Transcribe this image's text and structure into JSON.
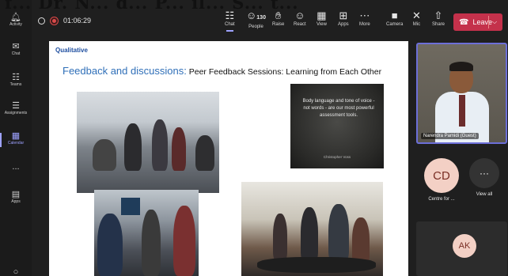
{
  "overlay_title": "f... Dr. N... d... P... il... S... t...",
  "rail": [
    {
      "label": "Activity",
      "icon": "bell-icon"
    },
    {
      "label": "Chat",
      "icon": "chat-icon"
    },
    {
      "label": "Teams",
      "icon": "teams-icon"
    },
    {
      "label": "Assignments",
      "icon": "assignments-icon"
    },
    {
      "label": "Calendar",
      "icon": "calendar-icon"
    },
    {
      "label": "...",
      "icon": "more-icon"
    },
    {
      "label": "Apps",
      "icon": "apps-icon"
    },
    {
      "label": "",
      "icon": "help-icon"
    }
  ],
  "meeting": {
    "timer": "01:06:29"
  },
  "toolbar": {
    "chat": "Chat",
    "people": "People",
    "people_count": "130",
    "raise": "Raise",
    "react": "React",
    "view": "View",
    "apps": "Apps",
    "more": "More",
    "camera": "Camera",
    "mic": "Mic",
    "share": "Share",
    "leave": "Leave"
  },
  "slide": {
    "tag": "Qualitative",
    "title_main": "Feedback and discussions:",
    "title_sub": " Peer Feedback Sessions: Learning from Each Other",
    "quote": "Body language and tone of voice - not words - are our most powerful assessment tools.",
    "quote_attr": "Christopher Voss"
  },
  "participants": {
    "presenter_name": "Narendra Pamidi (Guest)",
    "tiles": [
      {
        "initials": "CD",
        "label": "Centre for ..."
      },
      {
        "initials": "···",
        "label": "View all"
      }
    ],
    "bottom_initials": "AK"
  },
  "colors": {
    "accent": "#9ea2ff",
    "leave": "#c4314b",
    "slide_title": "#2f6fb8"
  }
}
